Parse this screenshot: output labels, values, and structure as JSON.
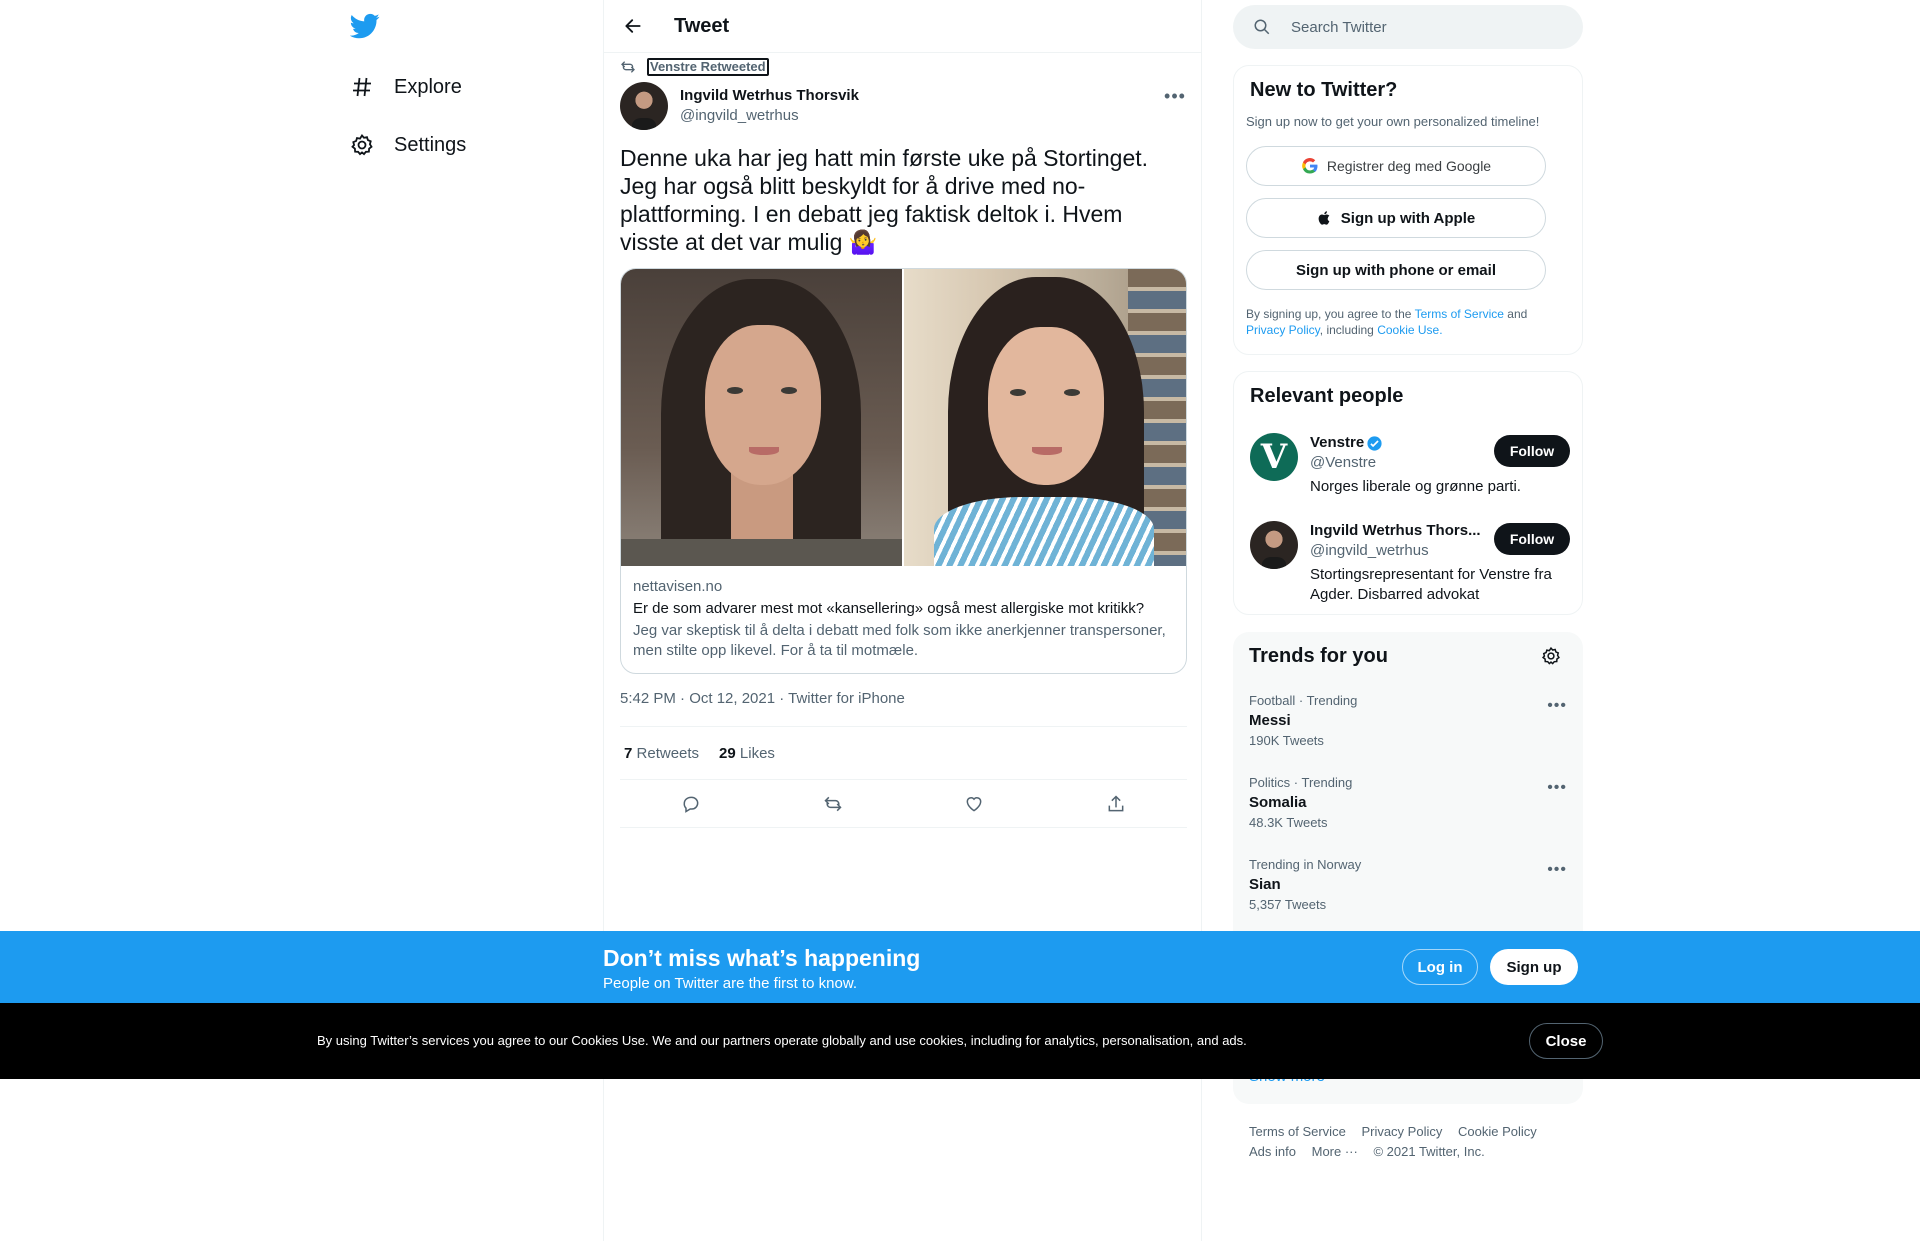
{
  "colors": {
    "brand": "#1d9bf0",
    "text": "#0f1419",
    "muted": "#536471",
    "border": "#eff3f4"
  },
  "nav": {
    "logo_icon": "twitter-bird-icon",
    "items": [
      {
        "label": "Explore",
        "icon": "hashtag-icon"
      },
      {
        "label": "Settings",
        "icon": "gear-icon"
      }
    ]
  },
  "header": {
    "title": "Tweet",
    "back_icon": "arrow-left-icon"
  },
  "tweet": {
    "retweeted_by": "Venstre Retweeted",
    "author_name": "Ingvild Wetrhus Thorsvik",
    "author_handle": "@ingvild_wetrhus",
    "text": "Denne uka har jeg hatt min første uke på Stortinget. Jeg har også blitt beskyldt for å drive med no-plattforming. I en debatt jeg faktisk deltok i. Hvem visste at det var mulig 🤷‍♀️",
    "card": {
      "domain": "nettavisen.no",
      "title": "Er de som advarer mest mot «kansellering» også mest allergiske mot kritikk?",
      "description": "Jeg var skeptisk til å delta i debatt med folk som ikke anerkjenner transpersoner, men stilte opp likevel. For å ta til motmæle."
    },
    "timestamp": "5:42 PM · Oct 12, 2021 · Twitter for iPhone",
    "retweets_count": "7",
    "retweets_label": "Retweets",
    "likes_count": "29",
    "likes_label": "Likes"
  },
  "search": {
    "placeholder": "Search Twitter"
  },
  "new_to_twitter": {
    "title": "New to Twitter?",
    "subtitle": "Sign up now to get your own personalized timeline!",
    "google_button": "Registrer deg med Google",
    "apple_button": "Sign up with Apple",
    "phone_button": "Sign up with phone or email",
    "legal_prefix": "By signing up, you agree to the",
    "terms": "Terms of Service",
    "and": "and",
    "privacy": "Privacy Policy",
    "including": ", including",
    "cookie": "Cookie Use."
  },
  "relevant_people": {
    "title": "Relevant people",
    "people": [
      {
        "name": "Venstre",
        "handle": "@Venstre",
        "bio": "Norges liberale og grønne parti.",
        "follow": "Follow",
        "avatar_letter": "V"
      },
      {
        "name": "Ingvild Wetrhus Thors...",
        "handle": "@ingvild_wetrhus",
        "bio": "Stortingsrepresentant for Venstre fra Agder. Disbarred advokat",
        "follow": "Follow"
      }
    ]
  },
  "trends": {
    "title": "Trends for you",
    "items": [
      {
        "meta": "Football · Trending",
        "name": "Messi",
        "count": "190K Tweets"
      },
      {
        "meta": "Politics · Trending",
        "name": "Somalia",
        "count": "48.3K Tweets"
      },
      {
        "meta": "Trending in Norway",
        "name": "Sian",
        "count": "5,357 Tweets"
      }
    ],
    "show_more": "Show more"
  },
  "footer": {
    "terms": "Terms of Service",
    "privacy": "Privacy Policy",
    "cookie": "Cookie Policy",
    "ads": "Ads info",
    "more": "More ···",
    "copyright": "© 2021 Twitter, Inc."
  },
  "banner": {
    "heading": "Don’t miss what’s happening",
    "sub": "People on Twitter are the first to know.",
    "login": "Log in",
    "signup": "Sign up"
  },
  "cookie_bar": {
    "text": "By using Twitter’s services you agree to our Cookies Use. We and our partners operate globally and use cookies, including for analytics, personalisation, and ads.",
    "close": "Close"
  }
}
